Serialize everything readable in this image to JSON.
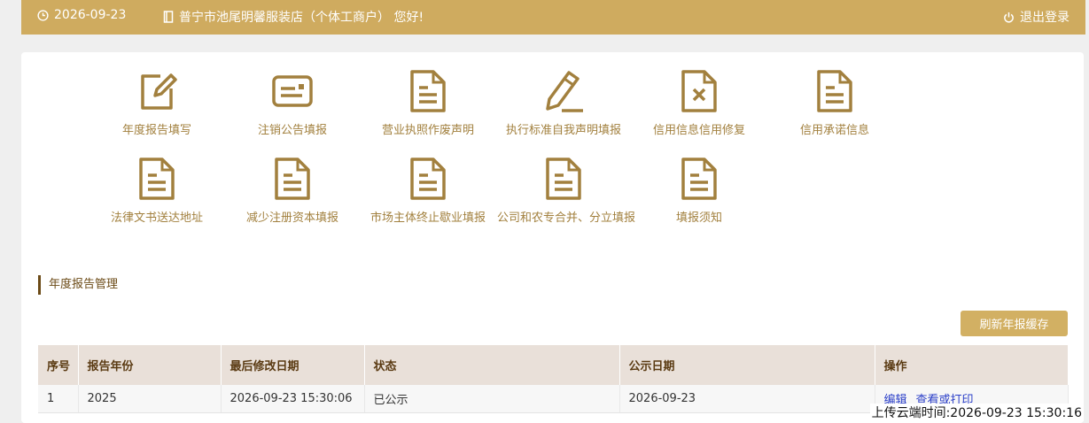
{
  "header": {
    "date": "2026-09-23",
    "greeting": "普宁市池尾明馨服装店（个体工商户） 您好!",
    "logout_label": "退出登录"
  },
  "tiles": [
    {
      "label": "年度报告填写",
      "icon": "edit-icon"
    },
    {
      "label": "注销公告填报",
      "icon": "id-card-icon"
    },
    {
      "label": "营业执照作废声明",
      "icon": "document-icon"
    },
    {
      "label": "执行标准自我声明填报",
      "icon": "pencil-icon"
    },
    {
      "label": "信用信息信用修复",
      "icon": "document-x-icon"
    },
    {
      "label": "信用承诺信息",
      "icon": "document-icon"
    },
    {
      "label": "法律文书送达地址",
      "icon": "document-icon"
    },
    {
      "label": "减少注册资本填报",
      "icon": "document-icon"
    },
    {
      "label": "市场主体终止歇业填报",
      "icon": "document-icon"
    },
    {
      "label": "公司和农专合并、分立填报",
      "icon": "document-icon"
    },
    {
      "label": "填报须知",
      "icon": "document-icon"
    }
  ],
  "annual_report": {
    "section_title": "年度报告管理",
    "refresh_label": "刷新年报缓存",
    "columns": [
      "序号",
      "报告年份",
      "最后修改日期",
      "状态",
      "公示日期",
      "操作"
    ],
    "rows": [
      {
        "index": "1",
        "year": "2025",
        "modified": "2026-09-23 15:30:06",
        "status": "已公示",
        "publish_date": "2026-09-23",
        "action_edit": "编辑",
        "action_view": "查看或打印"
      }
    ]
  },
  "footer": {
    "upload_time": "上传云端时间:2026-09-23 15:30:16"
  },
  "colors": {
    "brand": "#cfab5f",
    "icon": "#a2803e",
    "section_accent": "#6b4a16",
    "button": "#d2b063",
    "table_header": "#e9e0d9",
    "link": "#2b3fc8"
  }
}
